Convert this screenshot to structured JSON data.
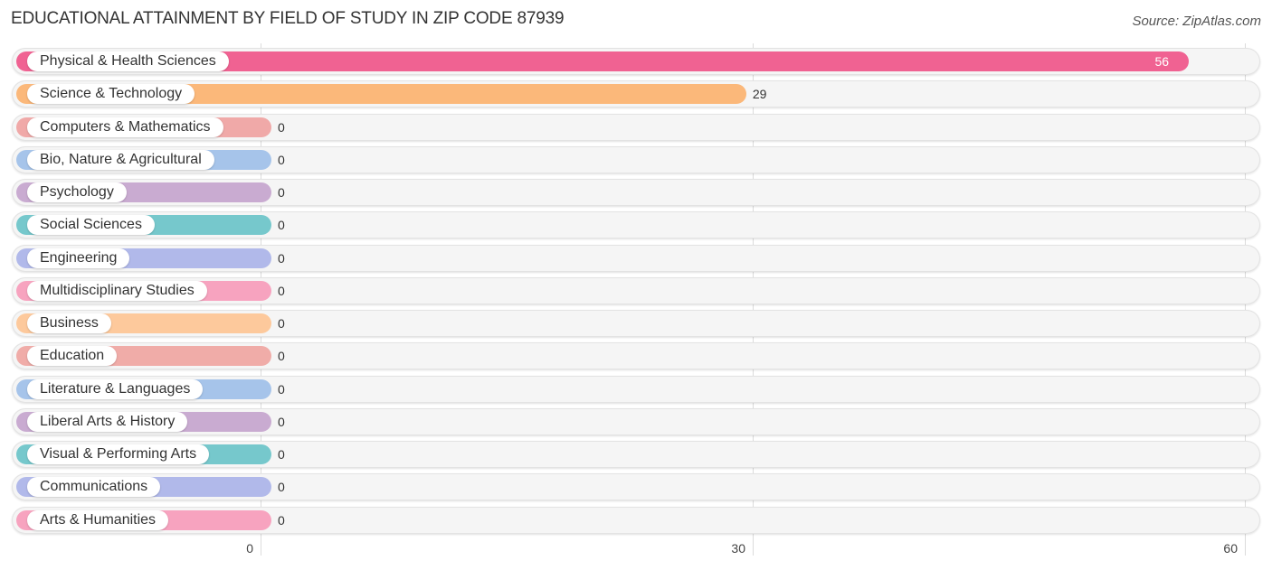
{
  "title": "EDUCATIONAL ATTAINMENT BY FIELD OF STUDY IN ZIP CODE 87939",
  "source": "Source: ZipAtlas.com",
  "chart_data": {
    "type": "bar",
    "orientation": "horizontal",
    "title": "EDUCATIONAL ATTAINMENT BY FIELD OF STUDY IN ZIP CODE 87939",
    "xlabel": "",
    "ylabel": "",
    "xlim": [
      0,
      60
    ],
    "ticks": [
      0,
      30,
      60
    ],
    "tick_labels": [
      "0",
      "30",
      "60"
    ],
    "grid": true,
    "categories": [
      "Physical & Health Sciences",
      "Science & Technology",
      "Computers & Mathematics",
      "Bio, Nature & Agricultural",
      "Psychology",
      "Social Sciences",
      "Engineering",
      "Multidisciplinary Studies",
      "Business",
      "Education",
      "Literature & Languages",
      "Liberal Arts & History",
      "Visual & Performing Arts",
      "Communications",
      "Arts & Humanities"
    ],
    "values": [
      56,
      29,
      0,
      0,
      0,
      0,
      0,
      0,
      0,
      0,
      0,
      0,
      0,
      0,
      0
    ],
    "value_labels": [
      "56",
      "29",
      "0",
      "0",
      "0",
      "0",
      "0",
      "0",
      "0",
      "0",
      "0",
      "0",
      "0",
      "0",
      "0"
    ],
    "colors": [
      "#f06292",
      "#fbb87a",
      "#f0a9a8",
      "#a6c4ea",
      "#c9abd1",
      "#76c8cc",
      "#b1b9ea",
      "#f7a3bf",
      "#fdc99c",
      "#f0aca8",
      "#a6c4ea",
      "#c9abd1",
      "#76c8cc",
      "#b1b9ea",
      "#f7a3bf"
    ]
  }
}
